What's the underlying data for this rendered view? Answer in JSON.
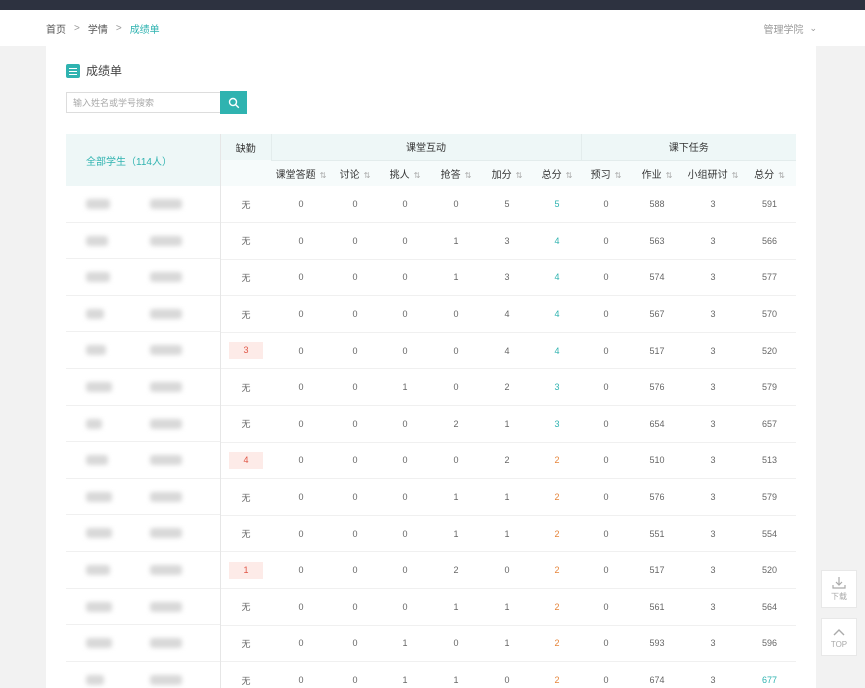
{
  "breadcrumb": {
    "home": "首页",
    "section": "学情",
    "current": "成绩单"
  },
  "header": {
    "org": "管理学院"
  },
  "page": {
    "title": "成绩单"
  },
  "search": {
    "placeholder": "输入姓名或学号搜索"
  },
  "table": {
    "all_students": "全部学生（114人）",
    "absence_header": "缺勤",
    "group_class": "课堂互动",
    "group_homework": "课下任务",
    "columns": [
      "课堂答题",
      "讨论",
      "挑人",
      "抢答",
      "加分",
      "总分",
      "预习",
      "作业",
      "小组研讨",
      "总分"
    ],
    "rows": [
      [
        "无",
        "0",
        "0",
        "0",
        "0",
        "5",
        "5",
        "0",
        "588",
        "3",
        "591"
      ],
      [
        "无",
        "0",
        "0",
        "0",
        "1",
        "3",
        "4",
        "0",
        "563",
        "3",
        "566"
      ],
      [
        "无",
        "0",
        "0",
        "0",
        "1",
        "3",
        "4",
        "0",
        "574",
        "3",
        "577"
      ],
      [
        "无",
        "0",
        "0",
        "0",
        "0",
        "4",
        "4",
        "0",
        "567",
        "3",
        "570"
      ],
      [
        "3",
        "0",
        "0",
        "0",
        "0",
        "4",
        "4",
        "0",
        "517",
        "3",
        "520"
      ],
      [
        "无",
        "0",
        "0",
        "1",
        "0",
        "2",
        "3",
        "0",
        "576",
        "3",
        "579"
      ],
      [
        "无",
        "0",
        "0",
        "0",
        "2",
        "1",
        "3",
        "0",
        "654",
        "3",
        "657"
      ],
      [
        "4",
        "0",
        "0",
        "0",
        "0",
        "2",
        "2",
        "0",
        "510",
        "3",
        "513"
      ],
      [
        "无",
        "0",
        "0",
        "0",
        "1",
        "1",
        "2",
        "0",
        "576",
        "3",
        "579"
      ],
      [
        "无",
        "0",
        "0",
        "0",
        "1",
        "1",
        "2",
        "0",
        "551",
        "3",
        "554"
      ],
      [
        "1",
        "0",
        "0",
        "0",
        "2",
        "0",
        "2",
        "0",
        "517",
        "3",
        "520"
      ],
      [
        "无",
        "0",
        "0",
        "0",
        "1",
        "1",
        "2",
        "0",
        "561",
        "3",
        "564"
      ],
      [
        "无",
        "0",
        "0",
        "1",
        "0",
        "1",
        "2",
        "0",
        "593",
        "3",
        "596"
      ],
      [
        "无",
        "0",
        "0",
        "1",
        "1",
        "0",
        "2",
        "0",
        "674",
        "3",
        "677"
      ]
    ]
  },
  "float_buttons": {
    "download": "下载",
    "top": "TOP"
  },
  "colors": {
    "accent": "#2fb3b0",
    "header_bar": "#2d3240",
    "absence_bg": "#fdebe8",
    "absence_text": "#e05545"
  }
}
